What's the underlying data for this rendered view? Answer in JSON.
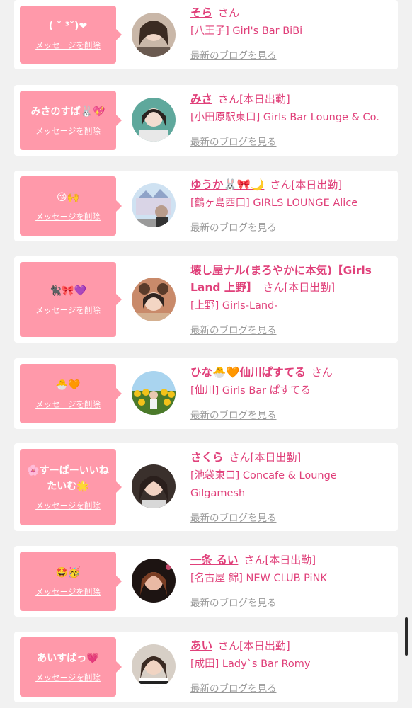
{
  "delete_label": "メッセージを削除",
  "blog_label": "最新のブログを見る",
  "san_label": "さん",
  "accent_color": "#ff99aa",
  "name_color": "#e0407a",
  "cards": [
    {
      "message": "( ˘ ³˘)❤",
      "name": "そら",
      "attendance": "",
      "shop": "[八王子] Girl's Bar BiBi"
    },
    {
      "message": "みさのすぱ🐰💖",
      "name": "みさ",
      "attendance": "[本日出勤]",
      "shop": "[小田原駅東口] Girls Bar Lounge & Co."
    },
    {
      "message": "😘🙌",
      "name": "ゆうか🐰🎀🌙",
      "attendance": "[本日出勤]",
      "shop": "[鶴ヶ島西口] GIRLS LOUNGE Alice"
    },
    {
      "message": "🐈‍⬛🎀💜",
      "name": "壊し屋ナル(まろやかに本気)【Girls Land 上野】",
      "attendance": "[本日出勤]",
      "shop": "[上野] Girls-Land-"
    },
    {
      "message": "🐣🧡",
      "name": "ひな🐣🧡仙川ぱすてる",
      "attendance": "",
      "shop": "[仙川] Girls Bar ぱすてる"
    },
    {
      "message": "🌸すーぱーいいねたいむ🌟",
      "name": "さくら",
      "attendance": "[本日出勤]",
      "shop": "[池袋東口] Concafe & Lounge Gilgamesh"
    },
    {
      "message": "🤩🥳",
      "name": "一条 るい",
      "attendance": "[本日出勤]",
      "shop": "[名古屋 錦] NEW CLUB PiNK"
    },
    {
      "message": "あいすぱっ💗",
      "name": "あい",
      "attendance": "[本日出勤]",
      "shop": "[成田] Lady`s Bar Romy"
    }
  ]
}
